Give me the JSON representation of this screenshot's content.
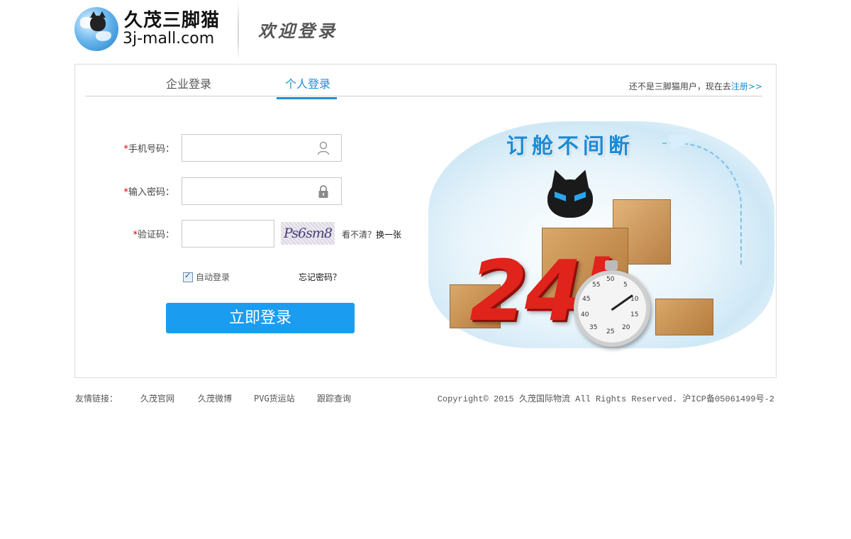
{
  "header": {
    "logo_cn": "久茂三脚猫",
    "logo_en": "3j-mall.com",
    "welcome": "欢迎登录"
  },
  "tabs": [
    {
      "label": "企业登录",
      "active": false
    },
    {
      "label": "个人登录",
      "active": true
    }
  ],
  "register": {
    "hint": "还不是三脚猫用户，现在去",
    "link": "注册>>"
  },
  "form": {
    "required_mark": "*",
    "phone_label": "手机号码：",
    "phone_value": "",
    "password_label": "输入密码：",
    "password_value": "",
    "captcha_label": "验证码：",
    "captcha_value": "",
    "captcha_image_text": "Ps6sm8",
    "captcha_hint": "看不清？",
    "captcha_refresh": "换一张",
    "auto_login_label": "自动登录",
    "auto_login_checked": true,
    "forgot_password": "忘记密码？",
    "submit": "立即登录"
  },
  "banner": {
    "slogan": "订舱不间断",
    "big_text": "24h",
    "stopwatch_numbers": [
      "50",
      "55",
      "5",
      "10",
      "15",
      "20",
      "25",
      "45",
      "40",
      "35"
    ]
  },
  "footer": {
    "friend_links_label": "友情链接：",
    "links": [
      "久茂官网",
      "久茂微博",
      "PVG货运站",
      "跟踪查询"
    ],
    "copyright": "Copyright© 2015 久茂国际物流 All Rights Reserved. 沪ICP备05061499号-2"
  },
  "colors": {
    "accent": "#1a8fd8",
    "button": "#1a9cf0",
    "required": "#dd0000",
    "big_text": "#e0231b"
  },
  "icons": {
    "phone_field": "user-icon",
    "password_field": "lock-icon"
  }
}
